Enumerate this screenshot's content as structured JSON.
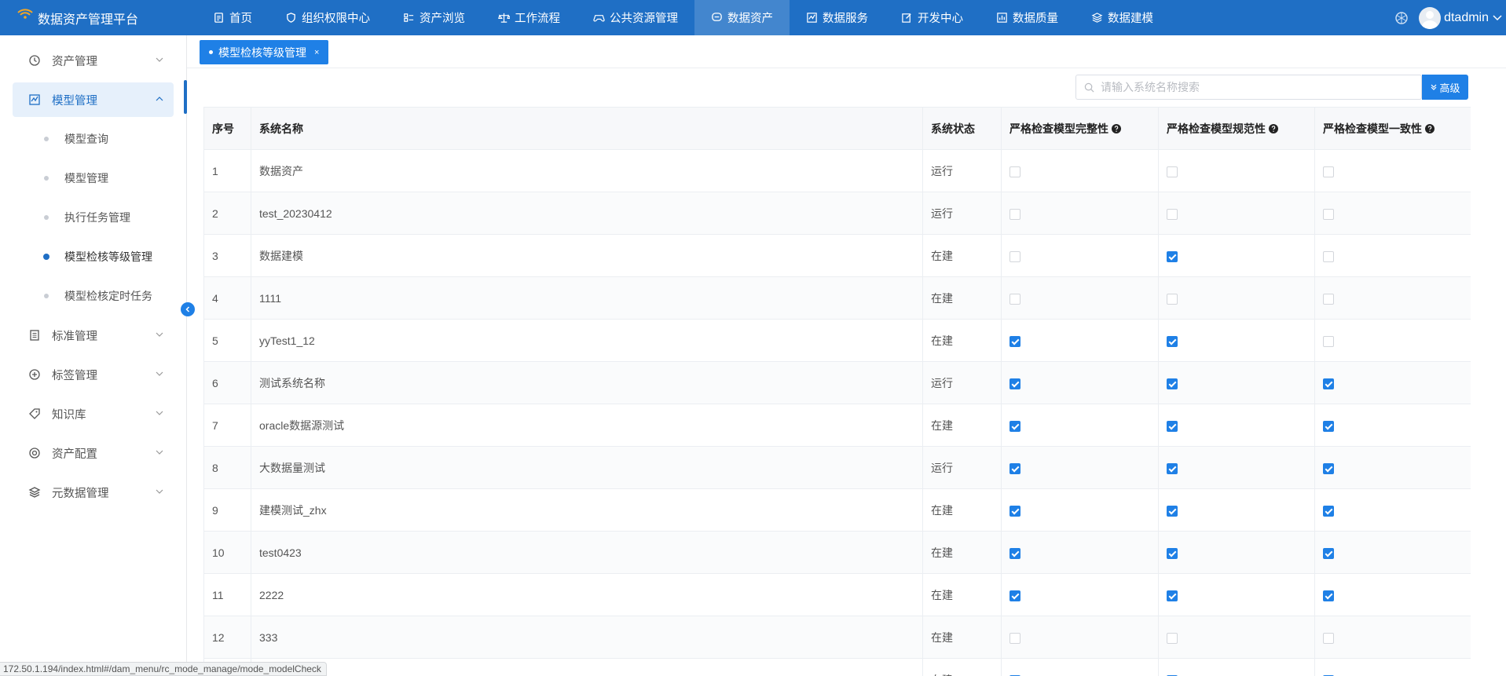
{
  "app": {
    "title": "数据资产管理平台"
  },
  "topnav": [
    {
      "label": "首页",
      "icon": "file-icon"
    },
    {
      "label": "组织权限中心",
      "icon": "shield-icon"
    },
    {
      "label": "资产浏览",
      "icon": "list-icon"
    },
    {
      "label": "工作流程",
      "icon": "scale-icon"
    },
    {
      "label": "公共资源管理",
      "icon": "gamepad-icon"
    },
    {
      "label": "数据资产",
      "icon": "chat-icon",
      "active": true
    },
    {
      "label": "数据服务",
      "icon": "chart-icon"
    },
    {
      "label": "开发中心",
      "icon": "edit-icon"
    },
    {
      "label": "数据质量",
      "icon": "bar-chart-icon"
    },
    {
      "label": "数据建模",
      "icon": "layers-icon"
    }
  ],
  "user": {
    "name": "dtadmin"
  },
  "sidebar": {
    "items": [
      {
        "label": "资产管理",
        "icon": "clock-icon"
      },
      {
        "label": "模型管理",
        "icon": "chart-icon",
        "open": true
      },
      {
        "label": "标准管理",
        "icon": "document-icon"
      },
      {
        "label": "标签管理",
        "icon": "plus-circle-icon"
      },
      {
        "label": "知识库",
        "icon": "tag-icon"
      },
      {
        "label": "资产配置",
        "icon": "target-icon"
      },
      {
        "label": "元数据管理",
        "icon": "layers-icon"
      }
    ],
    "submenu": [
      {
        "label": "模型查询"
      },
      {
        "label": "模型管理"
      },
      {
        "label": "执行任务管理"
      },
      {
        "label": "模型检核等级管理",
        "active": true
      },
      {
        "label": "模型检核定时任务"
      }
    ]
  },
  "tab": {
    "label": "模型检核等级管理",
    "close": "×"
  },
  "search": {
    "placeholder": "请输入系统名称搜索",
    "value": ""
  },
  "advanced_button": {
    "label": "高级"
  },
  "table": {
    "columns": [
      "序号",
      "系统名称",
      "系统状态",
      "严格检查模型完整性",
      "严格检查模型规范性",
      "严格检查模型一致性"
    ],
    "rows": [
      {
        "no": "1",
        "name": "数据资产",
        "status": "运行",
        "c1": false,
        "c2": false,
        "c3": false
      },
      {
        "no": "2",
        "name": "test_20230412",
        "status": "运行",
        "c1": false,
        "c2": false,
        "c3": false
      },
      {
        "no": "3",
        "name": "数据建模",
        "status": "在建",
        "c1": false,
        "c2": true,
        "c3": false
      },
      {
        "no": "4",
        "name": "1111",
        "status": "在建",
        "c1": false,
        "c2": false,
        "c3": false
      },
      {
        "no": "5",
        "name": "yyTest1_12",
        "status": "在建",
        "c1": true,
        "c2": true,
        "c3": false
      },
      {
        "no": "6",
        "name": "测试系统名称",
        "status": "运行",
        "c1": true,
        "c2": true,
        "c3": true
      },
      {
        "no": "7",
        "name": "oracle数据源测试",
        "status": "在建",
        "c1": true,
        "c2": true,
        "c3": true
      },
      {
        "no": "8",
        "name": "大数据量测试",
        "status": "运行",
        "c1": true,
        "c2": true,
        "c3": true
      },
      {
        "no": "9",
        "name": "建模测试_zhx",
        "status": "在建",
        "c1": true,
        "c2": true,
        "c3": true
      },
      {
        "no": "10",
        "name": "test0423",
        "status": "在建",
        "c1": true,
        "c2": true,
        "c3": true
      },
      {
        "no": "11",
        "name": "2222",
        "status": "在建",
        "c1": true,
        "c2": true,
        "c3": true
      },
      {
        "no": "12",
        "name": "333",
        "status": "在建",
        "c1": false,
        "c2": false,
        "c3": false
      },
      {
        "no": "",
        "name": "",
        "status": "在建",
        "c1": true,
        "c2": true,
        "c3": true
      }
    ]
  },
  "status_url": "172.50.1.194/index.html#/dam_menu/rc_mode_manage/mode_modelCheck",
  "colors": {
    "primary": "#1f80e6",
    "topbar": "#1f6fc5"
  }
}
